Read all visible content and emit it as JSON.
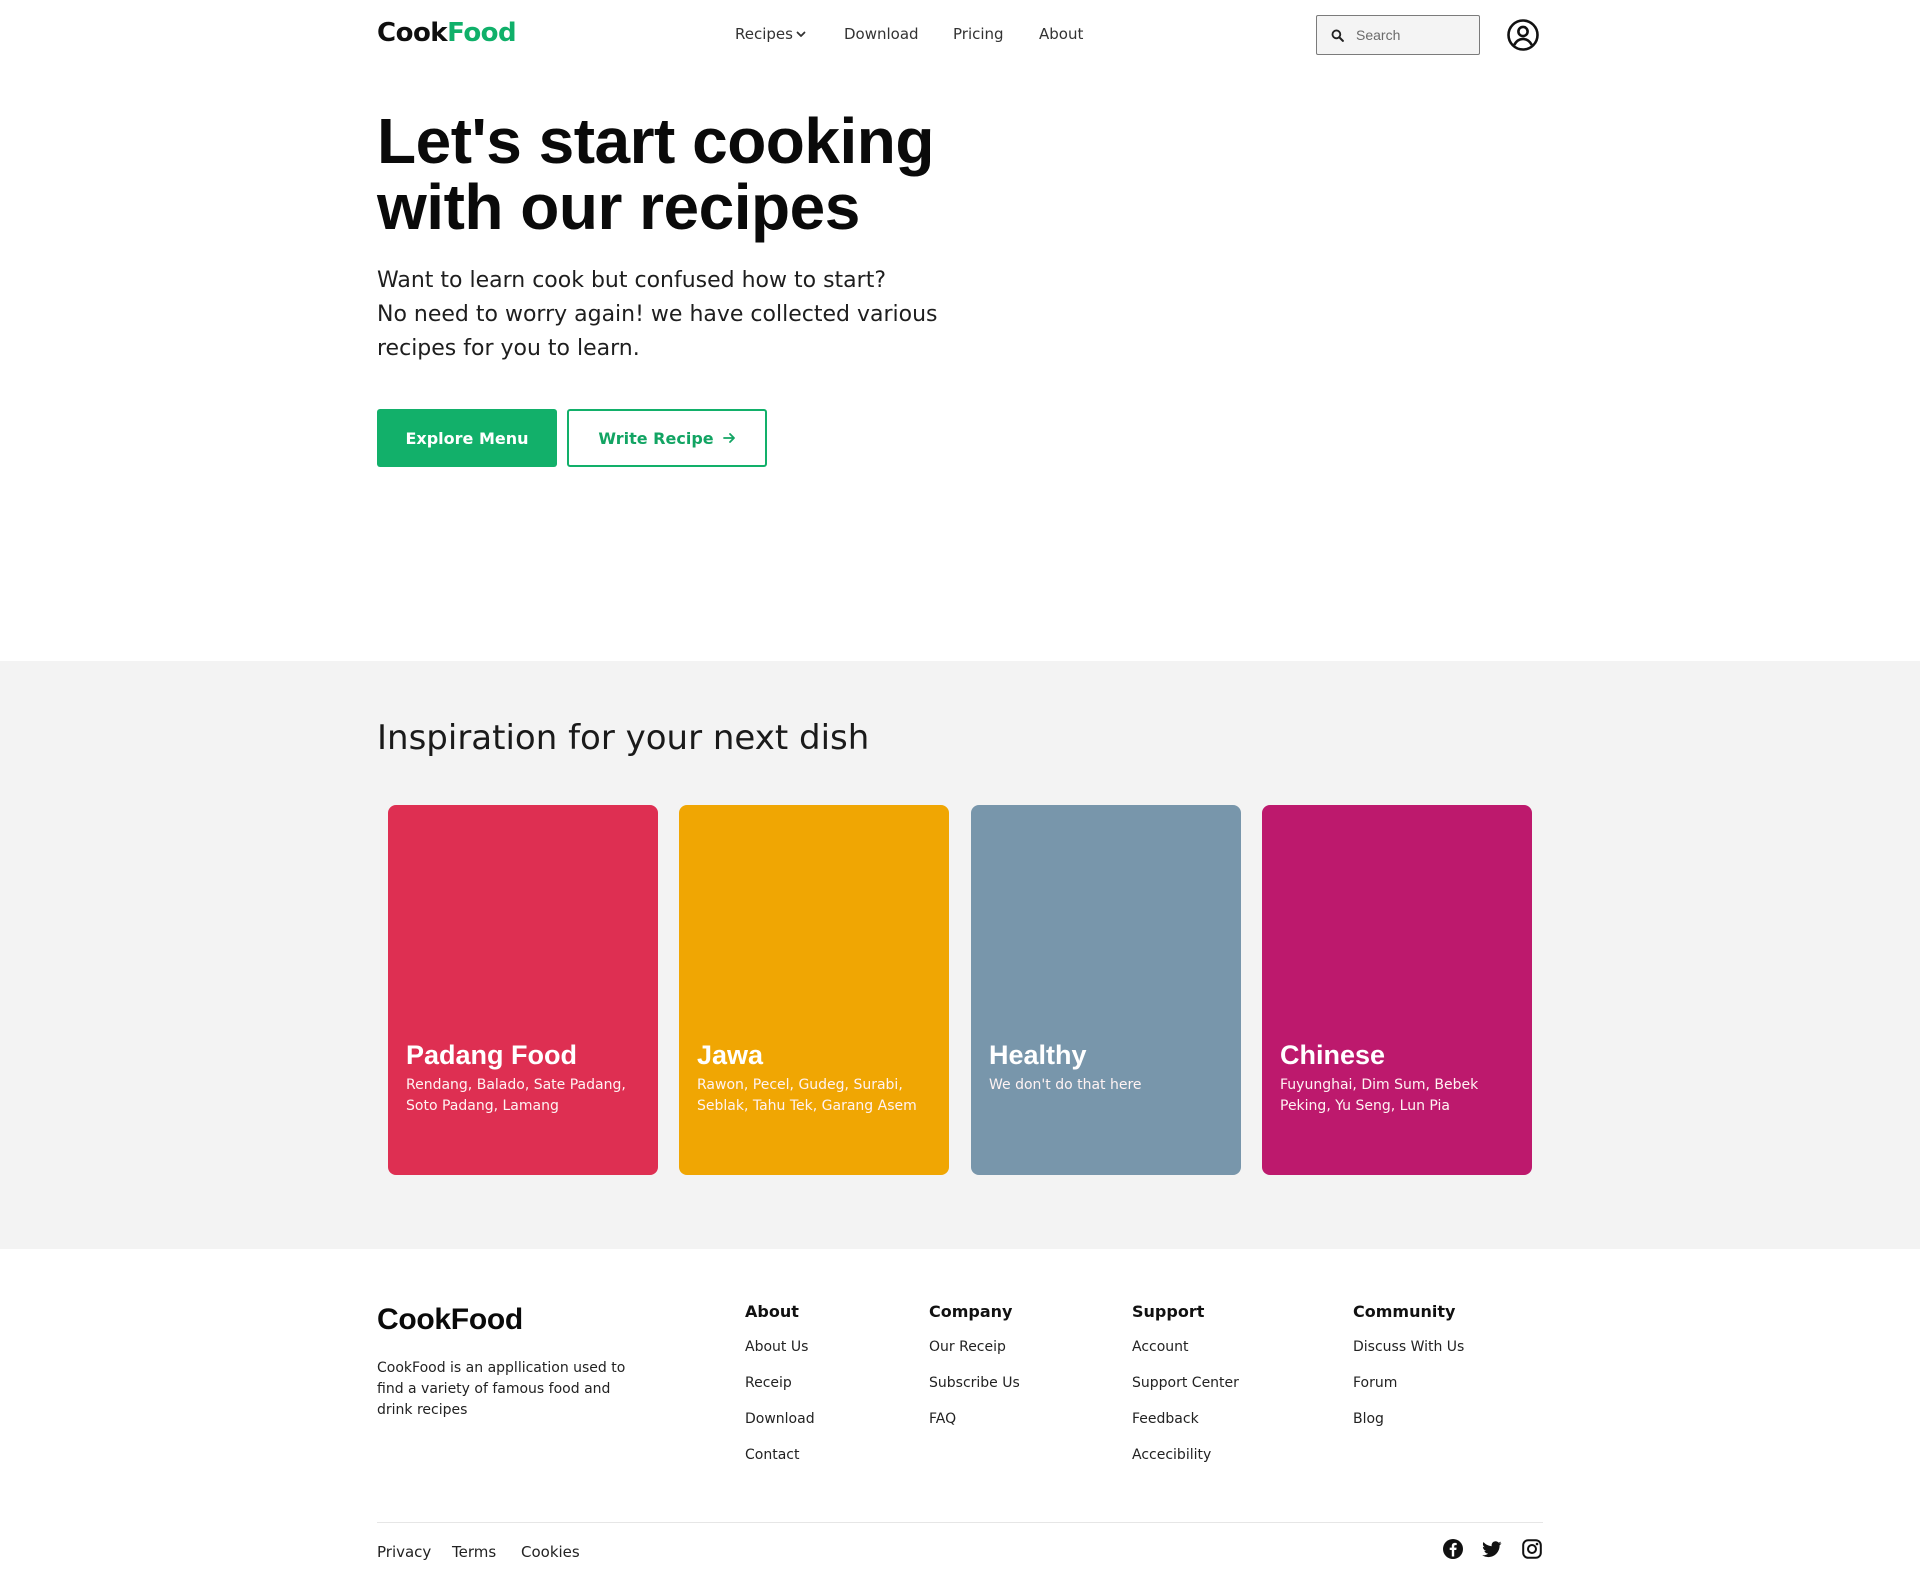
{
  "brand": {
    "prefix": "Cook",
    "accent": "Food",
    "accent_color": "#10b06a"
  },
  "nav": {
    "recipes": "Recipes",
    "download": "Download",
    "pricing": "Pricing",
    "about": "About"
  },
  "search": {
    "placeholder": "Search",
    "value": ""
  },
  "hero": {
    "title_line1": "Let's start cooking",
    "title_line2": "with our recipes",
    "subtitle_line1": "Want to learn cook but confused how to start?",
    "subtitle_line2": "No need to worry again! we have collected various",
    "subtitle_line3": "recipes for you to learn.",
    "primary_button": "Explore Menu",
    "secondary_button": "Write Recipe"
  },
  "inspiration": {
    "title": "Inspiration for your next dish",
    "cards": [
      {
        "title": "Padang Food",
        "description": "Rendang, Balado, Sate Padang, Soto Padang, Lamang",
        "color": "#de2f52"
      },
      {
        "title": "Jawa",
        "description": "Rawon, Pecel, Gudeg, Surabi, Seblak, Tahu Tek, Garang Asem",
        "color": "#f0a603"
      },
      {
        "title": "Healthy",
        "description": "We don't do that here",
        "color": "#7896ab"
      },
      {
        "title": "Chinese",
        "description": "Fuyunghai, Dim Sum, Bebek Peking, Yu Seng, Lun Pia",
        "color": "#bd196d"
      }
    ]
  },
  "footer": {
    "logo": "CookFood",
    "about_text": "CookFood is an appllication used to find a variety of famous food and drink recipes",
    "columns": [
      {
        "heading": "About",
        "links": [
          "About Us",
          "Receip",
          "Download",
          "Contact"
        ]
      },
      {
        "heading": "Company",
        "links": [
          "Our Receip",
          "Subscribe Us",
          "FAQ"
        ]
      },
      {
        "heading": "Support",
        "links": [
          "Account",
          "Support Center",
          "Feedback",
          "Accecibility"
        ]
      },
      {
        "heading": "Community",
        "links": [
          "Discuss With Us",
          "Forum",
          "Blog"
        ]
      }
    ],
    "legal": {
      "privacy": "Privacy",
      "terms": "Terms",
      "cookies": "Cookies"
    },
    "social_icons": [
      "facebook-icon",
      "twitter-icon",
      "instagram-icon"
    ]
  }
}
